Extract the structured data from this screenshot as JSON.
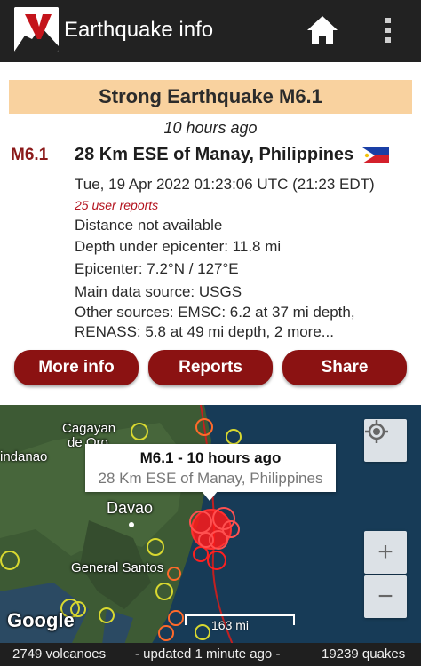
{
  "app": {
    "title": "Earthquake info",
    "logo_letter": "V",
    "icons": [
      "volcano-logo-icon",
      "home-icon",
      "overflow-menu-icon"
    ]
  },
  "quake": {
    "banner": "Strong Earthquake M6.1",
    "time_ago": "10 hours ago",
    "magnitude": "M6.1",
    "location": "28 Km ESE of Manay, Philippines",
    "flag": "philippines-flag-icon",
    "datetime": "Tue, 19 Apr 2022 01:23:06 UTC (21:23 EDT)",
    "user_reports": "25 user reports",
    "distance": "Distance not available",
    "depth": "Depth under epicenter: 11.8 mi",
    "epicenter": "Epicenter: 7.2°N / 127°E",
    "main_source": "Main data source: USGS",
    "other_sources_1": "Other sources: EMSC: 6.2 at 37 mi depth,",
    "other_sources_2": "RENASS: 5.8 at 49 mi depth, 2 more..."
  },
  "buttons": {
    "more_info": "More info",
    "reports": "Reports",
    "share": "Share"
  },
  "map": {
    "labels": {
      "cagayan": "Cagayan",
      "de_oro": "de Oro",
      "mindanao": "indanao",
      "davao": "Davao",
      "general_santos": "General Santos"
    },
    "popup_title": "M6.1  -  10 hours ago",
    "popup_subtitle": "28 Km ESE of Manay, Philippines",
    "google": "Google",
    "scale": "163 mi",
    "zoom_in": "+",
    "zoom_out": "−"
  },
  "status": {
    "volcanoes": "2749 volcanoes",
    "updated": "- updated 1 minute ago -",
    "quakes": "19239 quakes"
  },
  "colors": {
    "appbar": "#222222",
    "banner": "#f9d29f",
    "accent": "#8b1212",
    "quake_marker": "#ff1a1a"
  }
}
